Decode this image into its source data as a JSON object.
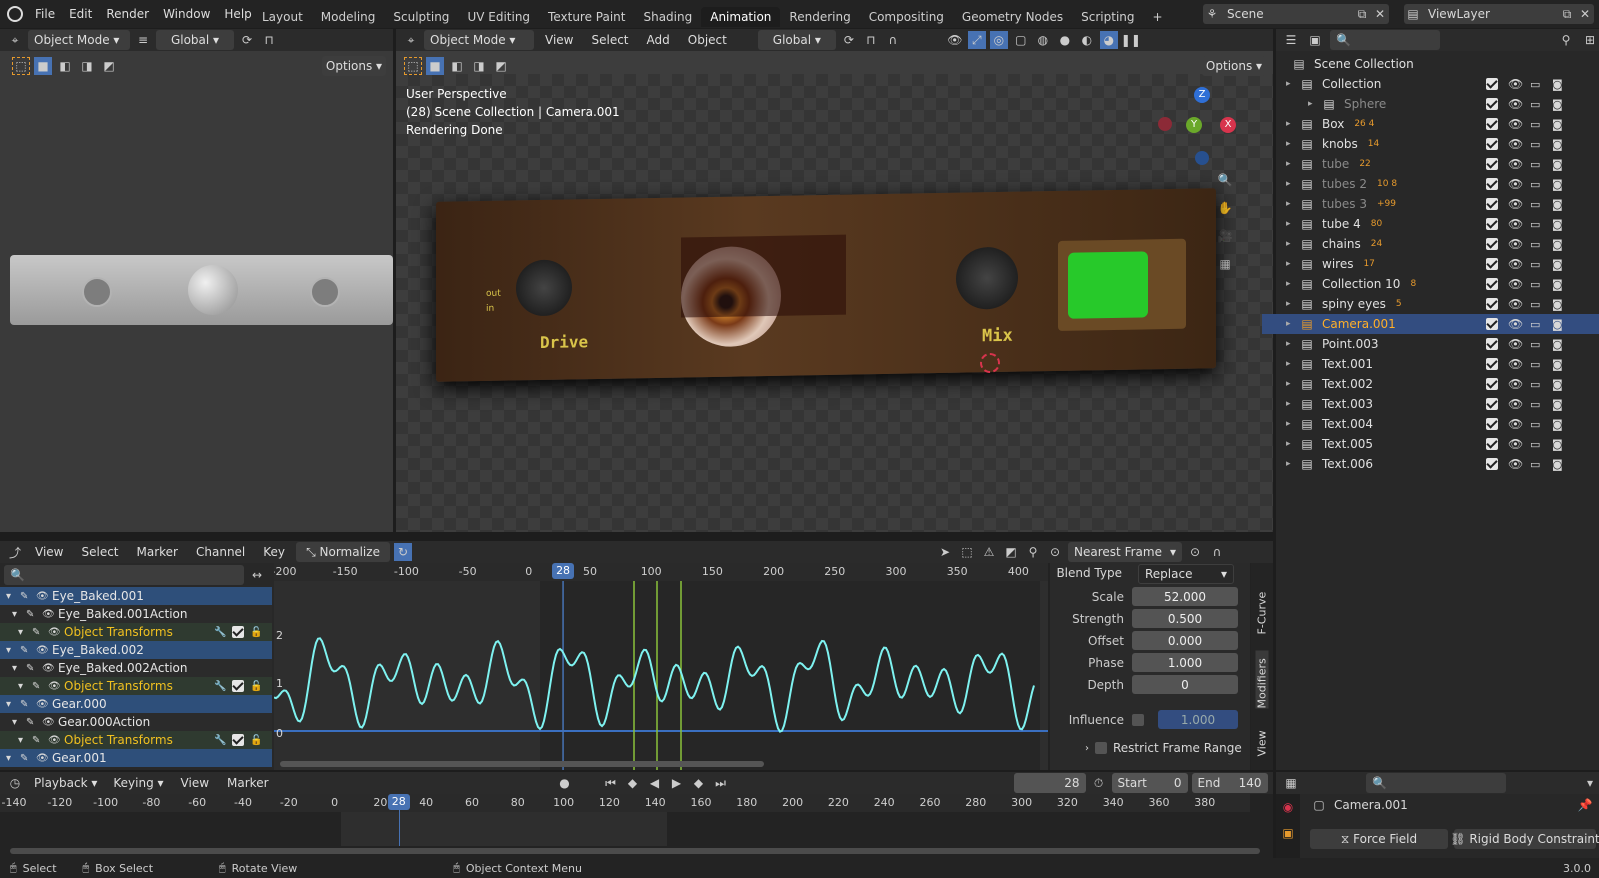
{
  "topbar": {
    "menus": [
      "File",
      "Edit",
      "Render",
      "Window",
      "Help"
    ],
    "workspaces": [
      "Layout",
      "Modeling",
      "Sculpting",
      "UV Editing",
      "Texture Paint",
      "Shading",
      "Animation",
      "Rendering",
      "Compositing",
      "Geometry Nodes",
      "Scripting"
    ],
    "active_workspace": "Animation",
    "scene": "Scene",
    "view_layer": "ViewLayer"
  },
  "left_view": {
    "mode": "Object Mode",
    "orientation": "Global",
    "options": "Options"
  },
  "main_view": {
    "mode": "Object Mode",
    "menus": [
      "View",
      "Select",
      "Add",
      "Object"
    ],
    "orientation": "Global",
    "options": "Options",
    "overlay_lines": [
      "User Perspective",
      "(28) Scene Collection | Camera.001",
      "Rendering Done"
    ],
    "scene_labels": {
      "drive": "Drive",
      "mix": "Mix",
      "out": "out",
      "in": "in"
    },
    "gizmo": {
      "z": "Z",
      "y": "Y",
      "x": "X"
    }
  },
  "outliner": {
    "root": "Scene Collection",
    "items": [
      {
        "name": "Collection",
        "badge": "",
        "dim": false,
        "selected": false
      },
      {
        "name": "Sphere",
        "badge": "",
        "dim": true,
        "selected": false
      },
      {
        "name": "Box",
        "badge": "26 4",
        "dim": false,
        "selected": false
      },
      {
        "name": "knobs",
        "badge": "14",
        "dim": false,
        "selected": false
      },
      {
        "name": "tube",
        "badge": "22",
        "dim": true,
        "selected": false
      },
      {
        "name": "tubes 2",
        "badge": "10 8",
        "dim": true,
        "selected": false
      },
      {
        "name": "tubes 3",
        "badge": "+99",
        "dim": true,
        "selected": false
      },
      {
        "name": "tube 4",
        "badge": "80",
        "dim": false,
        "selected": false
      },
      {
        "name": "chains",
        "badge": "24",
        "dim": false,
        "selected": false
      },
      {
        "name": "wires",
        "badge": "17",
        "dim": false,
        "selected": false
      },
      {
        "name": "Collection 10",
        "badge": "8",
        "dim": false,
        "selected": false
      },
      {
        "name": "spiny eyes",
        "badge": "5",
        "dim": false,
        "selected": false
      },
      {
        "name": "Camera.001",
        "badge": "",
        "dim": false,
        "selected": true
      },
      {
        "name": "Point.003",
        "badge": "",
        "dim": false,
        "selected": false
      },
      {
        "name": "Text.001",
        "badge": "",
        "dim": false,
        "selected": false
      },
      {
        "name": "Text.002",
        "badge": "",
        "dim": false,
        "selected": false
      },
      {
        "name": "Text.003",
        "badge": "",
        "dim": false,
        "selected": false
      },
      {
        "name": "Text.004",
        "badge": "",
        "dim": false,
        "selected": false
      },
      {
        "name": "Text.005",
        "badge": "",
        "dim": false,
        "selected": false
      },
      {
        "name": "Text.006",
        "badge": "",
        "dim": false,
        "selected": false
      }
    ]
  },
  "graph": {
    "menus": [
      "View",
      "Select",
      "Marker",
      "Channel",
      "Key"
    ],
    "normalize": "Normalize",
    "snap": "Nearest Frame",
    "ruler": [
      "-200",
      "-150",
      "-100",
      "-50",
      "0",
      "50",
      "100",
      "150",
      "200",
      "250",
      "300",
      "350",
      "400"
    ],
    "current_frame": "28",
    "y_ticks": [
      "2",
      "1",
      "0"
    ],
    "channels": [
      {
        "label": "Eye_Baked.001",
        "kind": "object"
      },
      {
        "label": "Eye_Baked.001Action",
        "kind": "action"
      },
      {
        "label": "Object Transforms",
        "kind": "group"
      },
      {
        "label": "Eye_Baked.002",
        "kind": "object"
      },
      {
        "label": "Eye_Baked.002Action",
        "kind": "action"
      },
      {
        "label": "Object Transforms",
        "kind": "group"
      },
      {
        "label": "Gear.000",
        "kind": "object"
      },
      {
        "label": "Gear.000Action",
        "kind": "action"
      },
      {
        "label": "Object Transforms",
        "kind": "group"
      },
      {
        "label": "Gear.001",
        "kind": "object"
      }
    ],
    "sidebar": {
      "blend_type_label": "Blend Type",
      "blend_type": "Replace",
      "fields": [
        {
          "label": "Scale",
          "value": "52.000"
        },
        {
          "label": "Strength",
          "value": "0.500"
        },
        {
          "label": "Offset",
          "value": "0.000"
        },
        {
          "label": "Phase",
          "value": "1.000"
        },
        {
          "label": "Depth",
          "value": "0"
        }
      ],
      "influence_label": "Influence",
      "influence": "1.000",
      "restrict": "Restrict Frame Range",
      "tabs": [
        "F-Curve",
        "Modifiers",
        "View"
      ]
    }
  },
  "timeline": {
    "menus": [
      "Playback",
      "Keying",
      "View",
      "Marker"
    ],
    "frame": "28",
    "start_label": "Start",
    "start": "0",
    "end_label": "End",
    "end": "140",
    "ruler": [
      "-140",
      "-120",
      "-100",
      "-80",
      "-60",
      "-40",
      "-20",
      "0",
      "20",
      "40",
      "60",
      "80",
      "100",
      "120",
      "140",
      "160",
      "180",
      "200",
      "220",
      "240",
      "260",
      "280",
      "300",
      "320",
      "340",
      "360",
      "380"
    ],
    "current_frame": "28"
  },
  "properties": {
    "object": "Camera.001",
    "buttons": [
      "Force Field",
      "Rigid Body Constraint"
    ]
  },
  "statusbar": {
    "items": [
      "Select",
      "Box Select",
      "Rotate View",
      "Object Context Menu"
    ],
    "version": "3.0.0"
  }
}
